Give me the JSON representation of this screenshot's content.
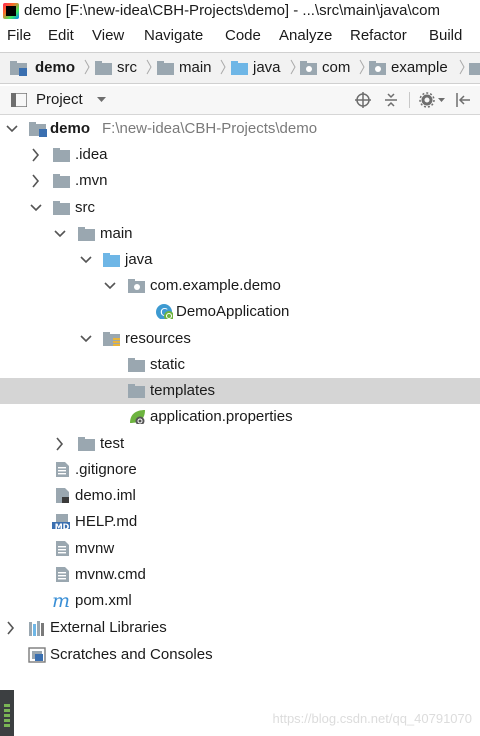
{
  "window": {
    "title": "demo [F:\\new-idea\\CBH-Projects\\demo] - ...\\src\\main\\java\\com"
  },
  "menu": [
    "File",
    "Edit",
    "View",
    "Navigate",
    "Code",
    "Analyze",
    "Refactor",
    "Build"
  ],
  "breadcrumb": [
    "demo",
    "src",
    "main",
    "java",
    "com",
    "example"
  ],
  "project_panel": {
    "label": "Project"
  },
  "tree": {
    "root_name": "demo",
    "root_path": "F:\\new-idea\\CBH-Projects\\demo",
    "idea": ".idea",
    "mvn": ".mvn",
    "src": "src",
    "main": "main",
    "java": "java",
    "package": "com.example.demo",
    "demo_application": "DemoApplication",
    "resources": "resources",
    "static": "static",
    "templates": "templates",
    "application_properties": "application.properties",
    "test": "test",
    "gitignore": ".gitignore",
    "demo_iml": "demo.iml",
    "help_md": "HELP.md",
    "mvnw": "mvnw",
    "mvnw_cmd": "mvnw.cmd",
    "pom_xml": "pom.xml",
    "external_libraries": "External Libraries",
    "scratches": "Scratches and Consoles"
  },
  "selected_item": "templates",
  "watermark": "https://blog.csdn.net/qq_40791070",
  "colors": {
    "folder": "#9aa7b0",
    "source_folder": "#6eb6e6",
    "selection": "#d5d5d5",
    "spring": "#6db33f"
  }
}
